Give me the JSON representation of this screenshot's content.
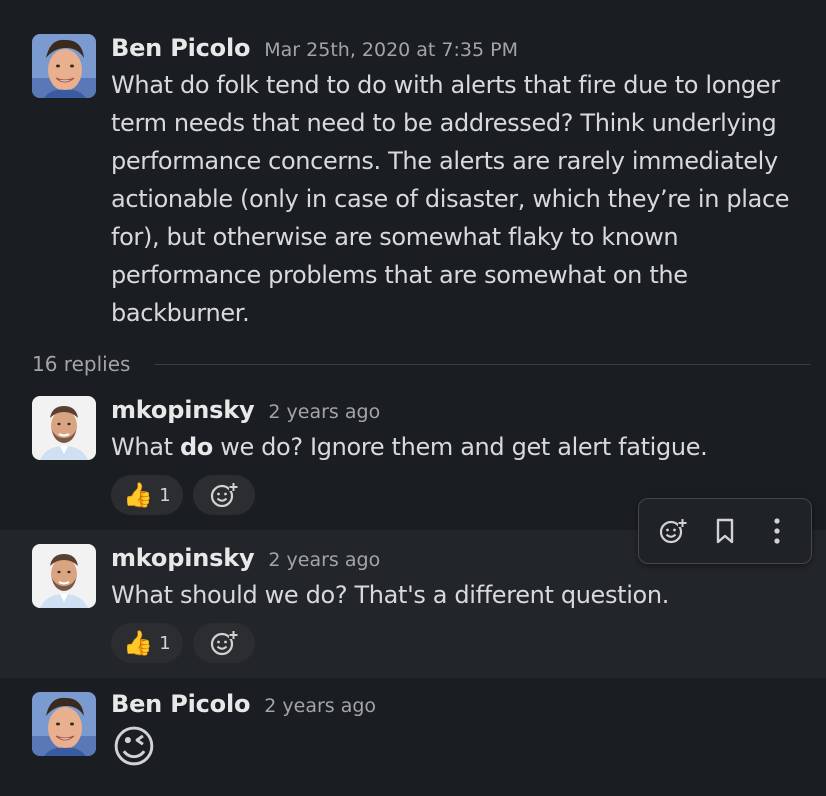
{
  "thread": {
    "parent": {
      "author": "Ben Picolo",
      "timestamp": "Mar 25th, 2020 at 7:35 PM",
      "text_lines": [
        "What do folk tend to do with alerts that fire due to longer",
        "term needs that need to be addressed? Think underlying",
        "performance concerns. The alerts are rarely immediately",
        "actionable (only in case of disaster, which they’re in place",
        "for), but otherwise are somewhat flaky to known",
        "performance problems that are somewhat on the",
        "backburner."
      ]
    },
    "replies_label": "16 replies",
    "replies": [
      {
        "author": "mkopinsky",
        "timestamp": "2 years ago",
        "text_before": "What ",
        "text_bold": "do",
        "text_after": " we do? Ignore them and get alert fatigue.",
        "reaction": {
          "emoji": "👍",
          "count": "1",
          "icon": "thumbs-up-icon"
        }
      },
      {
        "author": "mkopinsky",
        "timestamp": "2 years ago",
        "text": "What should we do? That's a different question.",
        "reaction": {
          "emoji": "👍",
          "count": "1",
          "icon": "thumbs-up-icon"
        }
      },
      {
        "author": "Ben Picolo",
        "timestamp": "2 years ago",
        "emoji": "😉"
      }
    ],
    "hover_actions": [
      "add-reaction-icon",
      "bookmark-icon",
      "more-actions-icon"
    ]
  },
  "colors": {
    "background": "#1a1d21",
    "hover_background": "#222529",
    "pill_background": "#2b2d31"
  }
}
